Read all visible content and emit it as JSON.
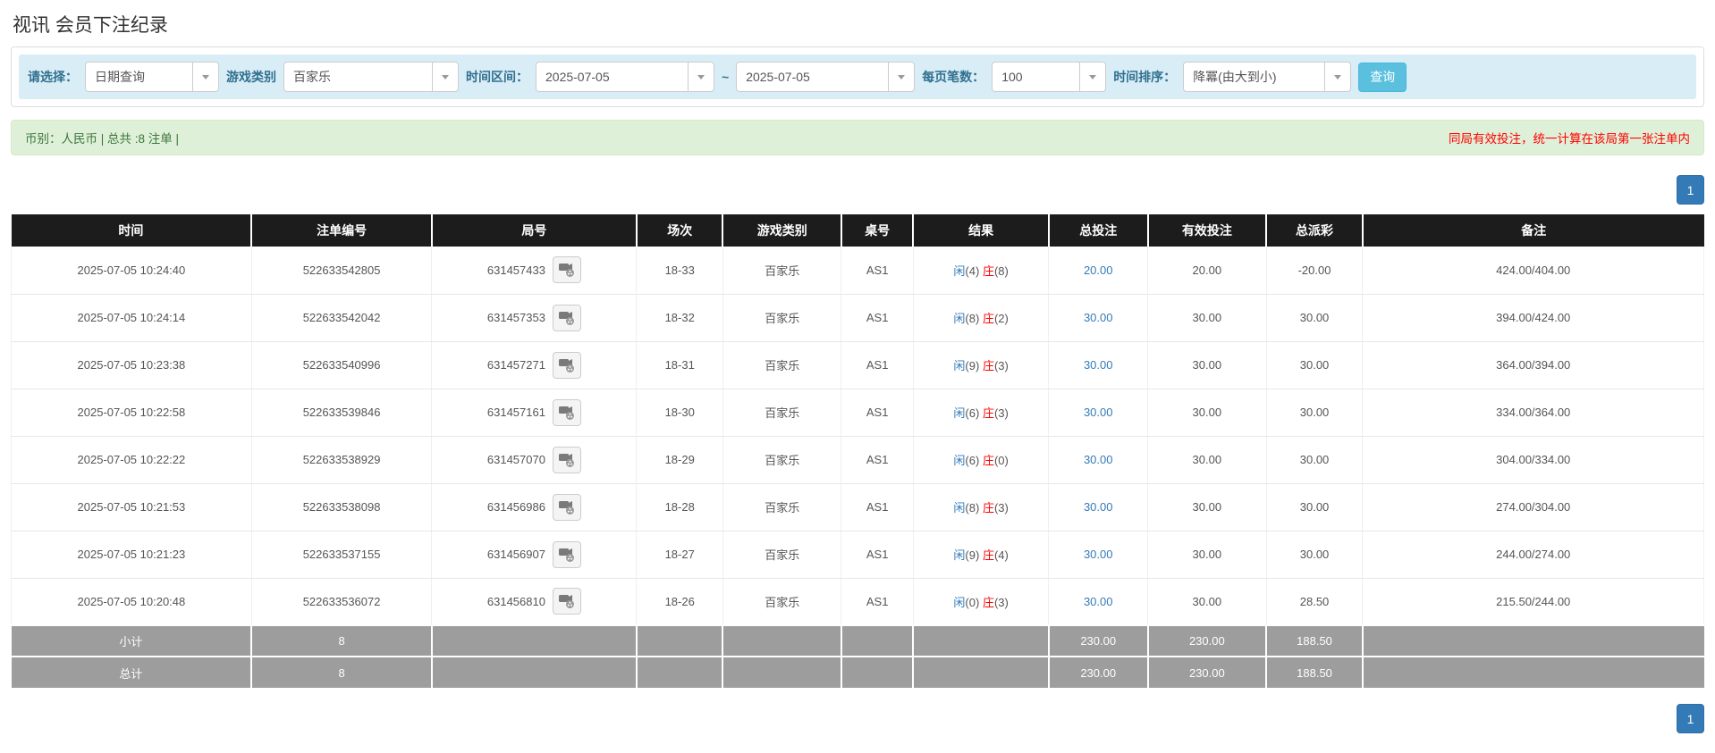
{
  "page_title": "视讯 会员下注纪录",
  "filter": {
    "select_label": "请选择：",
    "select_value": "日期查询",
    "game_label": "游戏类别",
    "game_value": "百家乐",
    "range_label": "时间区间：",
    "date_from": "2025-07-05",
    "tilde": "~",
    "date_to": "2025-07-05",
    "page_size_label": "每页笔数：",
    "page_size_value": "100",
    "sort_label": "时间排序：",
    "sort_value": "降冪(由大到小)",
    "search_button": "查询"
  },
  "summary_bar": {
    "left_text": "币别：人民币 | 总共 :8 注单 |",
    "right_note": "同局有效投注，统一计算在该局第一张注单内"
  },
  "pagination": {
    "page": "1"
  },
  "table": {
    "headers": [
      "时间",
      "注单编号",
      "局号",
      "场次",
      "游戏类别",
      "桌号",
      "结果",
      "总投注",
      "有效投注",
      "总派彩",
      "备注"
    ],
    "rows": [
      {
        "time": "2025-07-05 10:24:40",
        "bet_id": "522633542805",
        "round_id": "631457433",
        "session": "18-33",
        "game": "百家乐",
        "table_no": "AS1",
        "player": "闲",
        "player_pts": "(4)",
        "banker": "庄",
        "banker_pts": "(8)",
        "total_bet": "20.00",
        "valid_bet": "20.00",
        "payout": "-20.00",
        "payout_neg": true,
        "note": "424.00/404.00"
      },
      {
        "time": "2025-07-05 10:24:14",
        "bet_id": "522633542042",
        "round_id": "631457353",
        "session": "18-32",
        "game": "百家乐",
        "table_no": "AS1",
        "player": "闲",
        "player_pts": "(8)",
        "banker": "庄",
        "banker_pts": "(2)",
        "total_bet": "30.00",
        "valid_bet": "30.00",
        "payout": "30.00",
        "payout_neg": false,
        "note": "394.00/424.00"
      },
      {
        "time": "2025-07-05 10:23:38",
        "bet_id": "522633540996",
        "round_id": "631457271",
        "session": "18-31",
        "game": "百家乐",
        "table_no": "AS1",
        "player": "闲",
        "player_pts": "(9)",
        "banker": "庄",
        "banker_pts": "(3)",
        "total_bet": "30.00",
        "valid_bet": "30.00",
        "payout": "30.00",
        "payout_neg": false,
        "note": "364.00/394.00"
      },
      {
        "time": "2025-07-05 10:22:58",
        "bet_id": "522633539846",
        "round_id": "631457161",
        "session": "18-30",
        "game": "百家乐",
        "table_no": "AS1",
        "player": "闲",
        "player_pts": "(6)",
        "banker": "庄",
        "banker_pts": "(3)",
        "total_bet": "30.00",
        "valid_bet": "30.00",
        "payout": "30.00",
        "payout_neg": false,
        "note": "334.00/364.00"
      },
      {
        "time": "2025-07-05 10:22:22",
        "bet_id": "522633538929",
        "round_id": "631457070",
        "session": "18-29",
        "game": "百家乐",
        "table_no": "AS1",
        "player": "闲",
        "player_pts": "(6)",
        "banker": "庄",
        "banker_pts": "(0)",
        "total_bet": "30.00",
        "valid_bet": "30.00",
        "payout": "30.00",
        "payout_neg": false,
        "note": "304.00/334.00"
      },
      {
        "time": "2025-07-05 10:21:53",
        "bet_id": "522633538098",
        "round_id": "631456986",
        "session": "18-28",
        "game": "百家乐",
        "table_no": "AS1",
        "player": "闲",
        "player_pts": "(8)",
        "banker": "庄",
        "banker_pts": "(3)",
        "total_bet": "30.00",
        "valid_bet": "30.00",
        "payout": "30.00",
        "payout_neg": false,
        "note": "274.00/304.00"
      },
      {
        "time": "2025-07-05 10:21:23",
        "bet_id": "522633537155",
        "round_id": "631456907",
        "session": "18-27",
        "game": "百家乐",
        "table_no": "AS1",
        "player": "闲",
        "player_pts": "(9)",
        "banker": "庄",
        "banker_pts": "(4)",
        "total_bet": "30.00",
        "valid_bet": "30.00",
        "payout": "30.00",
        "payout_neg": false,
        "note": "244.00/274.00"
      },
      {
        "time": "2025-07-05 10:20:48",
        "bet_id": "522633536072",
        "round_id": "631456810",
        "session": "18-26",
        "game": "百家乐",
        "table_no": "AS1",
        "player": "闲",
        "player_pts": "(0)",
        "banker": "庄",
        "banker_pts": "(3)",
        "total_bet": "30.00",
        "valid_bet": "30.00",
        "payout": "28.50",
        "payout_neg": false,
        "note": "215.50/244.00"
      }
    ],
    "subtotal": {
      "label": "小计",
      "count": "8",
      "total_bet": "230.00",
      "valid_bet": "230.00",
      "payout": "188.50"
    },
    "total": {
      "label": "总计",
      "count": "8",
      "total_bet": "230.00",
      "valid_bet": "230.00",
      "payout": "188.50"
    }
  }
}
